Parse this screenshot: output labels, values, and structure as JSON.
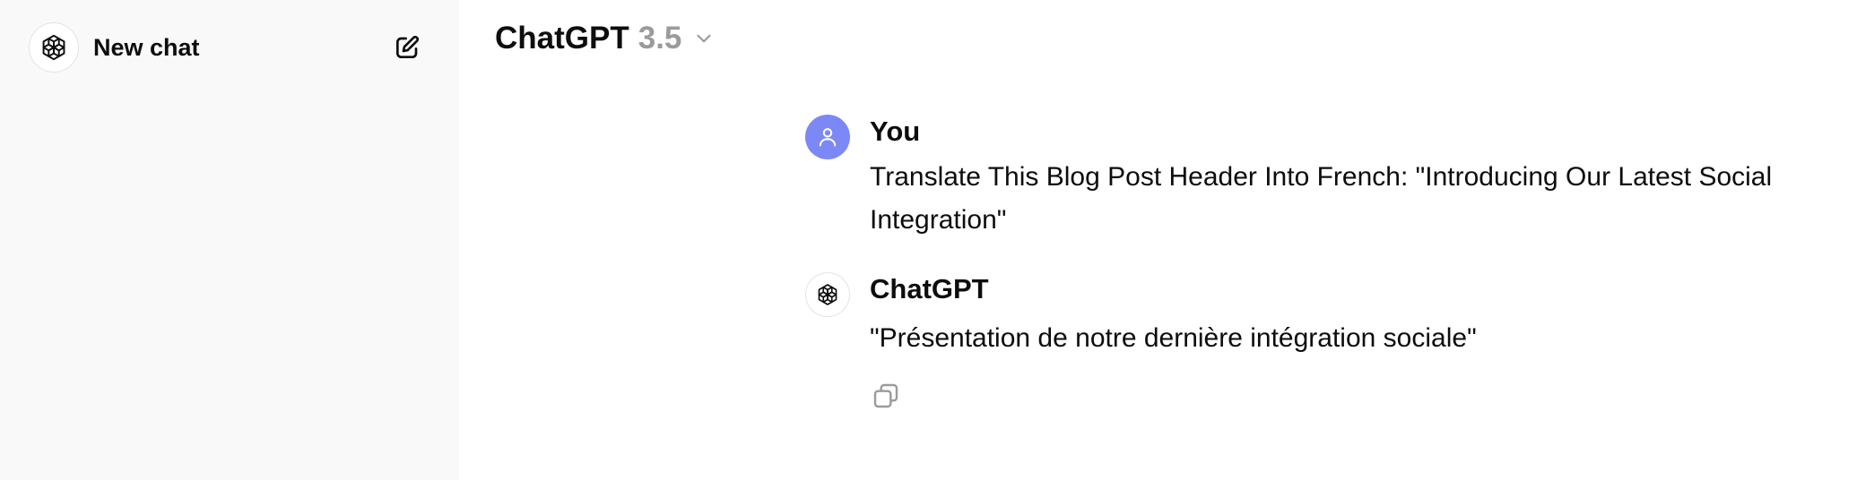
{
  "sidebar": {
    "new_chat_label": "New chat",
    "logo_icon": "openai-logo-icon",
    "edit_icon": "edit-icon"
  },
  "header": {
    "model_name": "ChatGPT",
    "model_version": "3.5",
    "chevron_icon": "chevron-down-icon"
  },
  "messages": [
    {
      "author": "You",
      "text": "Translate This Blog Post Header Into French: \"Introducing Our Latest Social Integration\"",
      "avatar_icon": "user-icon",
      "avatar_color": "#7b88f5"
    },
    {
      "author": "ChatGPT",
      "text": "\"Présentation de notre dernière intégration sociale\"",
      "avatar_icon": "openai-logo-icon",
      "action_icon": "copy-icon"
    }
  ],
  "colors": {
    "sidebar_bg": "#f9f9f9",
    "text": "#0d0d0d",
    "muted": "#9b9b9b"
  }
}
